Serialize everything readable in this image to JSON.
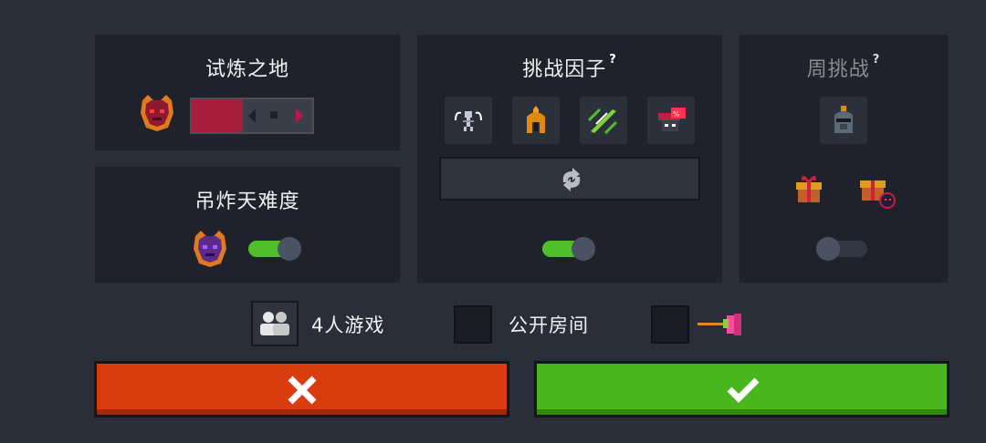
{
  "trial": {
    "title": "试炼之地"
  },
  "difficulty": {
    "title": "吊炸天难度",
    "toggle_on": true
  },
  "factors": {
    "title": "挑战因子",
    "help": "?",
    "toggle_on": true,
    "icons": [
      "jump-rope-skeleton-icon",
      "spartan-helmet-icon",
      "green-blades-icon",
      "discount-hat-icon"
    ]
  },
  "weekly": {
    "title": "周挑战",
    "help": "?",
    "toggle_on": false,
    "icons": [
      "knight-helmet-icon",
      "gift-box-icon",
      "gift-box-demon-icon"
    ]
  },
  "options": {
    "players_label": "4人游戏",
    "public_room_label": "公开房间",
    "public_room_checked": false,
    "hammer_checked": false
  },
  "colors": {
    "cancel": "#d93c0e",
    "confirm": "#48b61c",
    "toggle_on": "#4fbf2a"
  }
}
